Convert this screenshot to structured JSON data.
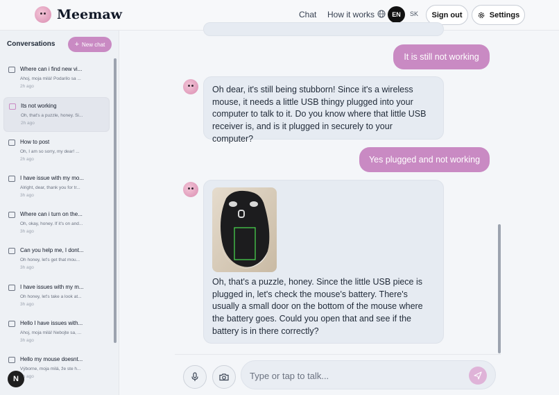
{
  "app": {
    "name": "Meemaw"
  },
  "nav": {
    "chat": "Chat",
    "how_it_works": "How it works",
    "lang_active": "EN",
    "lang_other": "SK",
    "sign_out": "Sign out",
    "settings": "Settings"
  },
  "sidebar": {
    "title": "Conversations",
    "new_chat": "New chat",
    "items": [
      {
        "title": "Where can i find new vi...",
        "preview": "Ahoj, moja milá! Podarilo sa ...",
        "time": "2h ago"
      },
      {
        "title": "Its not working",
        "preview": "Oh, that's a puzzle, honey. Si...",
        "time": "2h ago"
      },
      {
        "title": "How to post",
        "preview": "Oh, I am so sorry, my dear! ...",
        "time": "2h ago"
      },
      {
        "title": "I have issue with my mo...",
        "preview": "Alright, dear, thank you for tr...",
        "time": "3h ago"
      },
      {
        "title": "Where can i turn on the...",
        "preview": "Oh, okay, honey. If it's on and...",
        "time": "3h ago"
      },
      {
        "title": "Can you help me, I dont...",
        "preview": "Oh honey, let's get that mou...",
        "time": "3h ago"
      },
      {
        "title": "I have issues with my m...",
        "preview": "Oh honey, let's take a look at...",
        "time": "3h ago"
      },
      {
        "title": "Hello I have issues with...",
        "preview": "Ahoj, moja milá! Nebojte sa, ...",
        "time": "3h ago"
      },
      {
        "title": "Hello my mouse doesnt...",
        "preview": "Výborne, moja milá, že ste h...",
        "time": "3h ago"
      }
    ],
    "badge": "N"
  },
  "messages": {
    "user1": "It is still not working",
    "ai1": "Oh dear, it's still being stubborn! Since it's a wireless mouse, it needs a little USB thingy plugged into your computer to talk to it. Do you know where that little USB receiver is, and is it plugged in securely to your computer?",
    "user2": "Yes plugged and not working",
    "ai2": "Oh, that's a puzzle, honey. Since the little USB piece is plugged in, let's check the mouse's battery. There's usually a small door on the bottom of the mouse where the battery goes. Could you open that and see if the battery is in there correctly?"
  },
  "composer": {
    "placeholder": "Type or tap to talk..."
  },
  "colors": {
    "accent": "#c98ac3",
    "bubble_ai": "#e6ebf2",
    "dark": "#111111"
  },
  "icons": {
    "mic": "microphone-icon",
    "camera": "camera-icon",
    "send": "send-icon",
    "globe": "globe-icon",
    "gear": "gear-icon",
    "chat": "chat-bubble-icon",
    "plus": "plus-icon"
  }
}
